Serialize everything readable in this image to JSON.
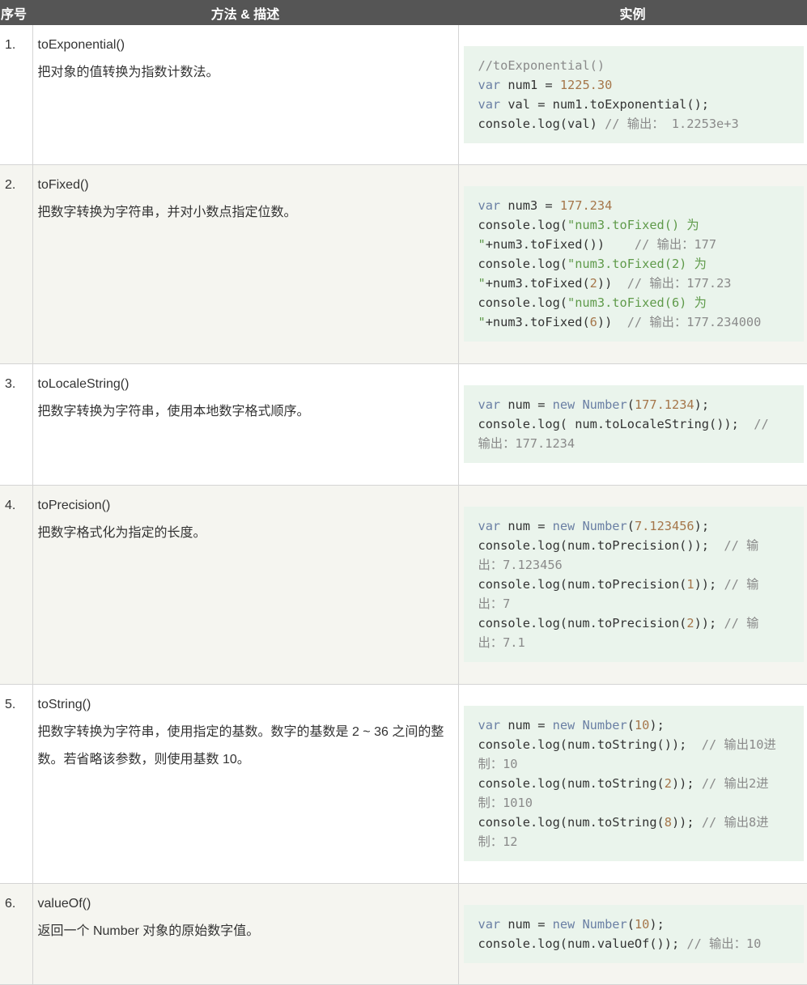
{
  "header": {
    "col_num": "序号",
    "col_desc": "方法 & 描述",
    "col_example": "实例"
  },
  "rows": [
    {
      "index": "1.",
      "method": "toExponential()",
      "description": "把对象的值转换为指数计数法。",
      "code": [
        [
          [
            "cm",
            "//toExponential()"
          ]
        ],
        [
          [
            "kw",
            "var"
          ],
          [
            "pl",
            " num1 = "
          ],
          [
            "num-lit",
            "1225.30"
          ]
        ],
        [
          [
            "kw",
            "var"
          ],
          [
            "pl",
            " val = num1.toExponential();"
          ]
        ],
        [
          [
            "pl",
            "console.log(val) "
          ],
          [
            "cm",
            "// 输出： 1.2253e+3"
          ]
        ]
      ]
    },
    {
      "index": "2.",
      "method": "toFixed()",
      "description": "把数字转换为字符串，并对小数点指定位数。",
      "code": [
        [
          [
            "kw",
            "var"
          ],
          [
            "pl",
            " num3 = "
          ],
          [
            "num-lit",
            "177.234"
          ]
        ],
        [
          [
            "pl",
            "console.log("
          ],
          [
            "str",
            "\"num3.toFixed() 为"
          ]
        ],
        [
          [
            "str",
            "\""
          ],
          [
            "pl",
            "+num3.toFixed())    "
          ],
          [
            "cm",
            "// 输出：177"
          ]
        ],
        [
          [
            "pl",
            "console.log("
          ],
          [
            "str",
            "\"num3.toFixed(2) 为"
          ]
        ],
        [
          [
            "str",
            "\""
          ],
          [
            "pl",
            "+num3.toFixed("
          ],
          [
            "num-lit",
            "2"
          ],
          [
            "pl",
            "))  "
          ],
          [
            "cm",
            "// 输出：177.23"
          ]
        ],
        [
          [
            "pl",
            "console.log("
          ],
          [
            "str",
            "\"num3.toFixed(6) 为"
          ]
        ],
        [
          [
            "str",
            "\""
          ],
          [
            "pl",
            "+num3.toFixed("
          ],
          [
            "num-lit",
            "6"
          ],
          [
            "pl",
            "))  "
          ],
          [
            "cm",
            "// 输出：177.234000"
          ]
        ]
      ]
    },
    {
      "index": "3.",
      "method": "toLocaleString()",
      "description": "把数字转换为字符串，使用本地数字格式顺序。",
      "code": [
        [
          [
            "kw",
            "var"
          ],
          [
            "pl",
            " num = "
          ],
          [
            "kw",
            "new"
          ],
          [
            "pl",
            " "
          ],
          [
            "kw",
            "Number"
          ],
          [
            "pl",
            "("
          ],
          [
            "num-lit",
            "177.1234"
          ],
          [
            "pl",
            ");"
          ]
        ],
        [
          [
            "pl",
            "console.log( num.toLocaleString());  "
          ],
          [
            "cm",
            "//"
          ]
        ],
        [
          [
            "cm",
            "输出：177.1234"
          ]
        ]
      ]
    },
    {
      "index": "4.",
      "method": "toPrecision()",
      "description": "把数字格式化为指定的长度。",
      "code": [
        [
          [
            "kw",
            "var"
          ],
          [
            "pl",
            " num = "
          ],
          [
            "kw",
            "new"
          ],
          [
            "pl",
            " "
          ],
          [
            "kw",
            "Number"
          ],
          [
            "pl",
            "("
          ],
          [
            "num-lit",
            "7.123456"
          ],
          [
            "pl",
            ");"
          ]
        ],
        [
          [
            "pl",
            "console.log(num.toPrecision());  "
          ],
          [
            "cm",
            "// 输"
          ]
        ],
        [
          [
            "cm",
            "出：7.123456"
          ]
        ],
        [
          [
            "pl",
            "console.log(num.toPrecision("
          ],
          [
            "num-lit",
            "1"
          ],
          [
            "pl",
            ")); "
          ],
          [
            "cm",
            "// 输"
          ]
        ],
        [
          [
            "cm",
            "出：7"
          ]
        ],
        [
          [
            "pl",
            "console.log(num.toPrecision("
          ],
          [
            "num-lit",
            "2"
          ],
          [
            "pl",
            ")); "
          ],
          [
            "cm",
            "// 输"
          ]
        ],
        [
          [
            "cm",
            "出：7.1"
          ]
        ]
      ]
    },
    {
      "index": "5.",
      "method": "toString()",
      "description": "把数字转换为字符串，使用指定的基数。数字的基数是 2 ~ 36 之间的整数。若省略该参数，则使用基数 10。",
      "code": [
        [
          [
            "kw",
            "var"
          ],
          [
            "pl",
            " num = "
          ],
          [
            "kw",
            "new"
          ],
          [
            "pl",
            " "
          ],
          [
            "kw",
            "Number"
          ],
          [
            "pl",
            "("
          ],
          [
            "num-lit",
            "10"
          ],
          [
            "pl",
            ");"
          ]
        ],
        [
          [
            "pl",
            "console.log(num.toString());  "
          ],
          [
            "cm",
            "// 输出10进"
          ]
        ],
        [
          [
            "cm",
            "制：10"
          ]
        ],
        [
          [
            "pl",
            "console.log(num.toString("
          ],
          [
            "num-lit",
            "2"
          ],
          [
            "pl",
            ")); "
          ],
          [
            "cm",
            "// 输出2进"
          ]
        ],
        [
          [
            "cm",
            "制：1010"
          ]
        ],
        [
          [
            "pl",
            "console.log(num.toString("
          ],
          [
            "num-lit",
            "8"
          ],
          [
            "pl",
            ")); "
          ],
          [
            "cm",
            "// 输出8进"
          ]
        ],
        [
          [
            "cm",
            "制：12"
          ]
        ]
      ]
    },
    {
      "index": "6.",
      "method": "valueOf()",
      "description": "返回一个 Number 对象的原始数字值。",
      "code": [
        [
          [
            "kw",
            "var"
          ],
          [
            "pl",
            " num = "
          ],
          [
            "kw",
            "new"
          ],
          [
            "pl",
            " "
          ],
          [
            "kw",
            "Number"
          ],
          [
            "pl",
            "("
          ],
          [
            "num-lit",
            "10"
          ],
          [
            "pl",
            ");"
          ]
        ],
        [
          [
            "pl",
            "console.log(num.valueOf()); "
          ],
          [
            "cm",
            "// 输出：10"
          ]
        ]
      ]
    }
  ]
}
